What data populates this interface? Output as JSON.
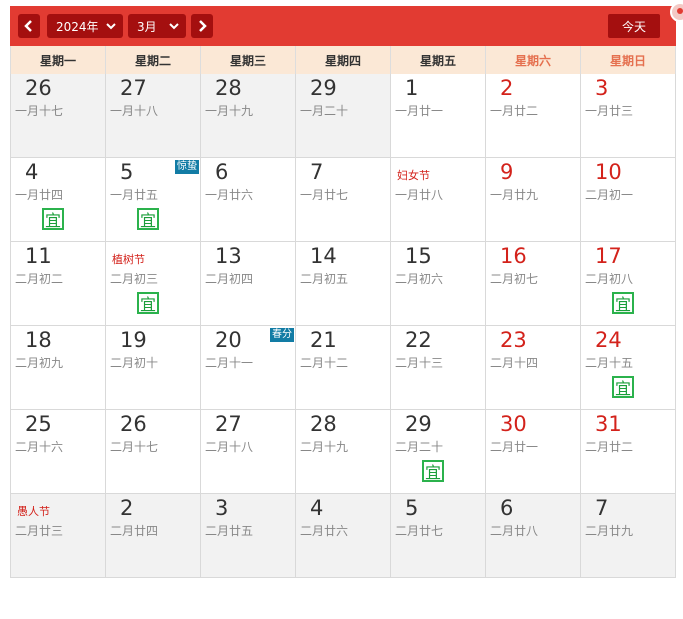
{
  "toolbar": {
    "year_label": "2024年",
    "month_label": "3月",
    "today_label": "今天",
    "accent_color": "#e23b32",
    "button_color": "#a40f0f"
  },
  "weekdays": [
    "星期一",
    "星期二",
    "星期三",
    "星期四",
    "星期五",
    "星期六",
    "星期日"
  ],
  "weeks": [
    [
      {
        "day": "26",
        "lunar": "一月十七",
        "other": true
      },
      {
        "day": "27",
        "lunar": "一月十八",
        "other": true
      },
      {
        "day": "28",
        "lunar": "一月十九",
        "other": true
      },
      {
        "day": "29",
        "lunar": "一月二十",
        "other": true
      },
      {
        "day": "1",
        "lunar": "一月廿一"
      },
      {
        "day": "2",
        "lunar": "一月廿二",
        "weekend": true
      },
      {
        "day": "3",
        "lunar": "一月廿三",
        "weekend": true
      }
    ],
    [
      {
        "day": "4",
        "lunar": "一月廿四",
        "yi": "宜"
      },
      {
        "day": "5",
        "lunar": "一月廿五",
        "yi": "宜",
        "term": "惊蛰"
      },
      {
        "day": "6",
        "lunar": "一月廿六"
      },
      {
        "day": "7",
        "lunar": "一月廿七"
      },
      {
        "day": "",
        "lunar": "一月廿八",
        "festival": "妇女节"
      },
      {
        "day": "9",
        "lunar": "一月廿九",
        "weekend": true
      },
      {
        "day": "10",
        "lunar": "二月初一",
        "weekend": true
      }
    ],
    [
      {
        "day": "11",
        "lunar": "二月初二"
      },
      {
        "day": "",
        "lunar": "二月初三",
        "festival": "植树节",
        "yi": "宜"
      },
      {
        "day": "13",
        "lunar": "二月初四"
      },
      {
        "day": "14",
        "lunar": "二月初五"
      },
      {
        "day": "15",
        "lunar": "二月初六"
      },
      {
        "day": "16",
        "lunar": "二月初七",
        "weekend": true
      },
      {
        "day": "17",
        "lunar": "二月初八",
        "weekend": true,
        "yi": "宜"
      }
    ],
    [
      {
        "day": "18",
        "lunar": "二月初九"
      },
      {
        "day": "19",
        "lunar": "二月初十"
      },
      {
        "day": "20",
        "lunar": "二月十一",
        "term": "春分"
      },
      {
        "day": "21",
        "lunar": "二月十二"
      },
      {
        "day": "22",
        "lunar": "二月十三"
      },
      {
        "day": "23",
        "lunar": "二月十四",
        "weekend": true
      },
      {
        "day": "24",
        "lunar": "二月十五",
        "weekend": true,
        "yi": "宜"
      }
    ],
    [
      {
        "day": "25",
        "lunar": "二月十六"
      },
      {
        "day": "26",
        "lunar": "二月十七"
      },
      {
        "day": "27",
        "lunar": "二月十八"
      },
      {
        "day": "28",
        "lunar": "二月十九"
      },
      {
        "day": "29",
        "lunar": "二月二十",
        "yi": "宜"
      },
      {
        "day": "30",
        "lunar": "二月廿一",
        "weekend": true
      },
      {
        "day": "31",
        "lunar": "二月廿二",
        "weekend": true
      }
    ],
    [
      {
        "day": "",
        "lunar": "二月廿三",
        "festival": "愚人节",
        "other": true
      },
      {
        "day": "2",
        "lunar": "二月廿四",
        "other": true
      },
      {
        "day": "3",
        "lunar": "二月廿五",
        "other": true
      },
      {
        "day": "4",
        "lunar": "二月廿六",
        "other": true
      },
      {
        "day": "5",
        "lunar": "二月廿七",
        "other": true
      },
      {
        "day": "6",
        "lunar": "二月廿八",
        "other": true
      },
      {
        "day": "7",
        "lunar": "二月廿九",
        "other": true
      }
    ]
  ]
}
